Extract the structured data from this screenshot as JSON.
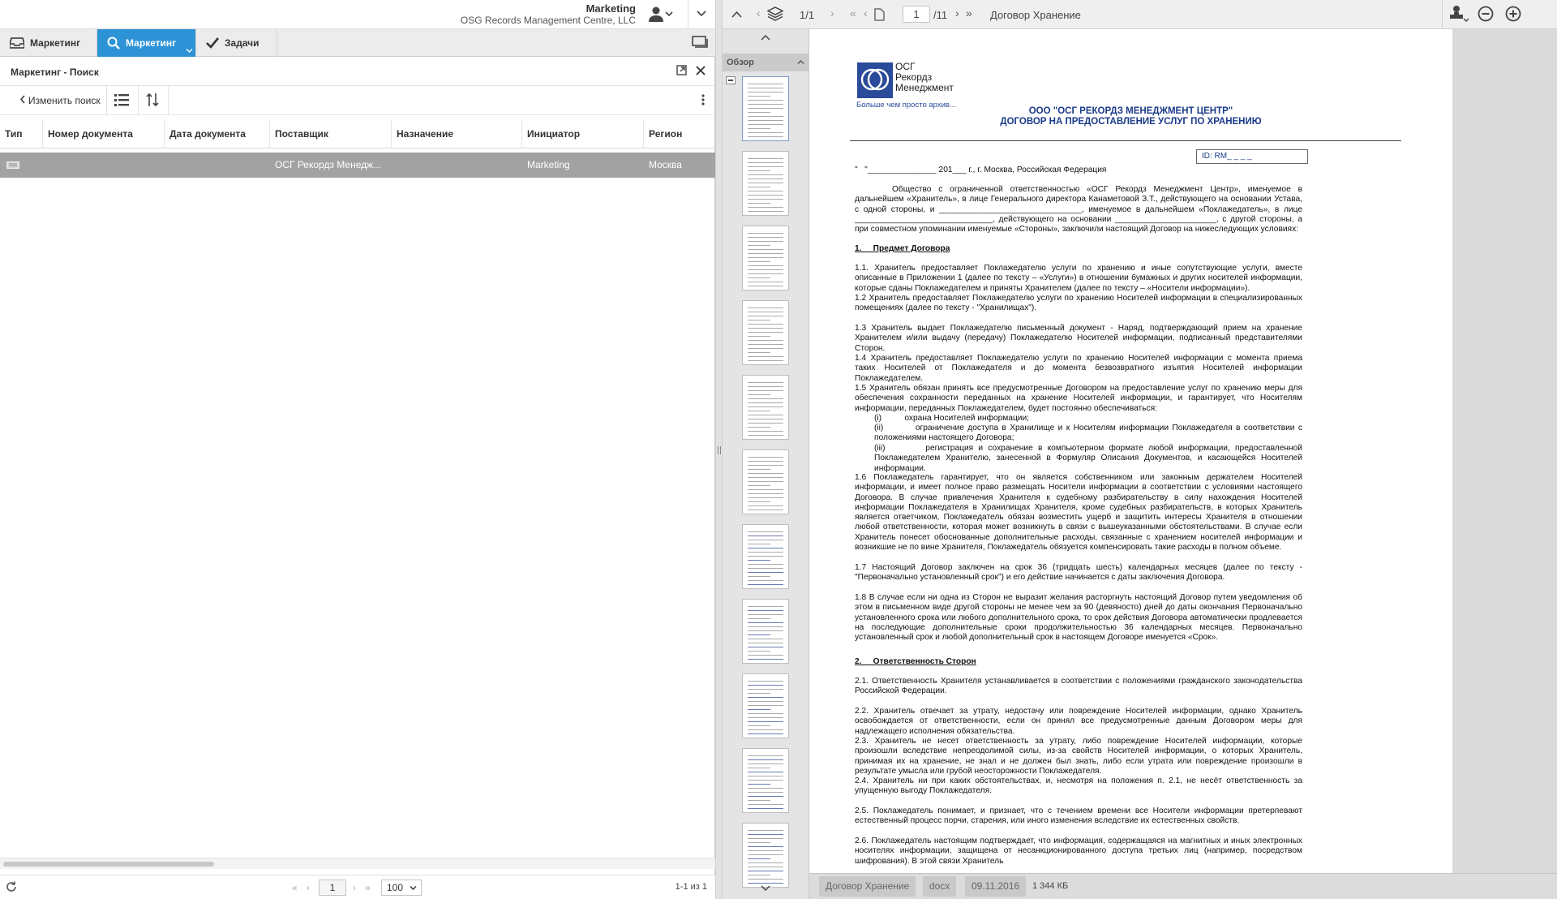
{
  "header": {
    "user_name": "Marketing",
    "organization": "OSG Records Management Centre, LLC"
  },
  "tabs": [
    {
      "label": "Маркетинг",
      "icon": "inbox-icon"
    },
    {
      "label": "Маркетинг",
      "icon": "search-icon"
    },
    {
      "label": "Задачи",
      "icon": "check-icon"
    }
  ],
  "panel": {
    "title": "Маркетинг - Поиск",
    "change_search": "Изменить поиск"
  },
  "table": {
    "columns": [
      "Тип",
      "Номер документа",
      "Дата документа",
      "Поставщик",
      "Назначение",
      "Инициатор",
      "Регион"
    ],
    "rows": [
      {
        "type_icon": "document-type-icon",
        "number": "",
        "date": "",
        "supplier": "ОСГ Рекордз Менедж...",
        "purpose": "",
        "initiator": "Marketing",
        "region": "Москва"
      }
    ]
  },
  "pagination": {
    "page": "1",
    "page_size": "100",
    "summary": "1-1 из 1"
  },
  "viewer": {
    "doc_counter": "1/1",
    "page_input": "1",
    "page_total": "/11",
    "doc_title": "Договор Хранение",
    "thumbnails_label": "Обзор",
    "colors": {
      "accent": "#2d93d6",
      "selected_row": "#a2a2a2"
    }
  },
  "document": {
    "logo_text_1": "ОСГ",
    "logo_text_2": "Рекордз",
    "logo_text_3": "Менеджмент",
    "logo_tagline": "Больше чем просто архив...",
    "org_heading": "ООО \"ОСГ РЕКОРДЗ МЕНЕДЖМЕНТ ЦЕНТР\"",
    "doc_heading": "ДОГОВОР НА ПРЕДОСТАВЛЕНИЕ УСЛУГ ПО ХРАНЕНИЮ",
    "id_field": "ID: RM_ _ _ _",
    "date_line": "\"   \"_______________ 201___ г., г. Москва, Российская Федерация",
    "intro": "Общество с ограниченной ответственностью «ОСГ Рекордз Менеджмент Центр», именуемое в дальнейшем «Хранитель», в лице Генерального директора Канаметовой З.Т., действующего на основании Устава, с одной стороны, и _______________________________, именуемое в дальнейшем «Поклажедатель», в лице ______________________________, действующего на основании ______________________, с другой стороны, а при совместном упоминании именуемые «Стороны», заключили настоящий Договор на нижеследующих условиях:",
    "section1": "1.     Предмет Договора",
    "p1_1": "1.1. Хранитель предоставляет Поклажедателю услуги по хранению и иные сопутствующие услуги, вместе описанные в Приложении 1 (далее по тексту – «Услуги») в отношении бумажных и других носителей информации, которые сданы Поклажедателем и приняты Хранителем (далее по тексту – «Носители информации»).",
    "p1_2": "1.2   Хранитель предоставляет Поклажедателю услуги по хранению Носителей информации в специализированных помещениях (далее по тексту - \"Хранилищах\").",
    "p1_3": "1.3   Хранитель выдает Поклажедателю письменный документ - Наряд, подтверждающий прием на хранение Хранителем и/или выдачу (передачу) Поклажедателю Носителей информации, подписанный представителями Сторон.",
    "p1_4": "1.4   Хранитель предоставляет Поклажедателю услуги по хранению Носителей информации с момента приема таких Носителей от Поклажедателя и до момента безвозвратного изъятия Носителей информации Поклажедателем.",
    "p1_5": "1.5   Хранитель обязан принять все предусмотренные Договором на предоставление услуг по хранению меры для обеспечения сохранности переданных на хранение Носителей информации, и гарантирует, что Носителям информации, переданных Поклажедателем, будет постоянно обеспечиваться:",
    "p1_5_i": "(i)          охрана Носителей информации;",
    "p1_5_ii": "(ii)         ограничение доступа в Хранилище и к Носителям информации Поклажедателя в соответствии с положениями настоящего Договора;",
    "p1_5_iii": "(iii)        регистрация и сохранение в компьютерном формате любой информации, предоставленной Поклажедателем Хранителю, занесенной в Формуляр Описания Документов, и касающейся Носителей информации.",
    "p1_6": "1.6   Поклажедатель гарантирует, что он является собственником или законным держателем Носителей информации, и имеет полное право размещать Носители информации в соответствии с условиями настоящего Договора. В случае привлечения Хранителя к судебному разбирательству в силу нахождения Носителей информации Поклажедателя в Хранилищах Хранителя, кроме судебных разбирательств, в которых Хранитель является ответчиком, Поклажедатель обязан возместить ущерб и защитить интересы Хранителя в отношении любой ответственности, которая может возникнуть в связи с вышеуказанными обстоятельствами. В случае если Хранитель понесет обоснованные дополнительные расходы, связанные с хранением носителей информации и возникшие не по вине Хранителя, Поклажедатель обязуется компенсировать такие расходы в полном объеме.",
    "p1_7": "1.7   Настоящий Договор заключен на срок 36 (тридцать шесть) календарных месяцев (далее по тексту - \"Первоначально установленный срок\") и его действие начинается с даты заключения Договора.",
    "p1_8": "1.8   В случае если ни одна из Сторон не выразит желания расторгнуть настоящий Договор путем уведомления об этом в письменном виде другой стороны не менее чем за 90 (девяносто) дней до даты окончания Первоначально установленного срока или любого дополнительного срока, то срок действия Договора автоматически продлевается на последующие дополнительные сроки продолжительностью 36 календарных месяцев. Первоначально установленный срок и любой дополнительный срок в настоящем Договоре именуется «Срок».",
    "section2": "2.     Ответственность Сторон",
    "p2_1": "2.1. Ответственность  Хранителя устанавливается в соответствии с положениями гражданского законодательства Российской Федерации.",
    "p2_2": "2.2. Хранитель отвечает за утрату, недостачу или повреждение Носителей информации, однако Хранитель освобождается от ответственности, если он принял все предусмотренные данным Договором меры для надлежащего исполнения обязательства.",
    "p2_3": "2.3. Хранитель не несет ответственность за утрату, либо повреждение Носителей информации, которые произошли вследствие непреодолимой силы, из-за свойств Носителей информации, о которых Хранитель, принимая их на хранение, не знал и не должен был знать, либо если утрата или повреждение произошли в результате умысла или грубой неосторожности Поклажедателя.",
    "p2_4": "2.4. Хранитель ни при каких обстоятельствах, и, несмотря на положения п. 2.1, не несёт ответственность за упущенную выгоду Поклажедателя.",
    "p2_5": "2.5. Поклажедатель понимает, и признает, что с течением времени все Носители информации  претерпевают естественный процесс порчи, старения, или иного изменения вследствие их естественных свойств.",
    "p2_6": "2.6. Поклажедатель настоящим подтверждает, что информация, содержащаяся на магнитных и иных электронных носителях информации, защищена от несанкционированного доступа третьих лиц (например, посредством шифрования). В этой связи Хранитель"
  },
  "status": {
    "name": "Договор Хранение",
    "format": "docx",
    "date": "09.11.2016",
    "size": "1 344 КБ"
  }
}
